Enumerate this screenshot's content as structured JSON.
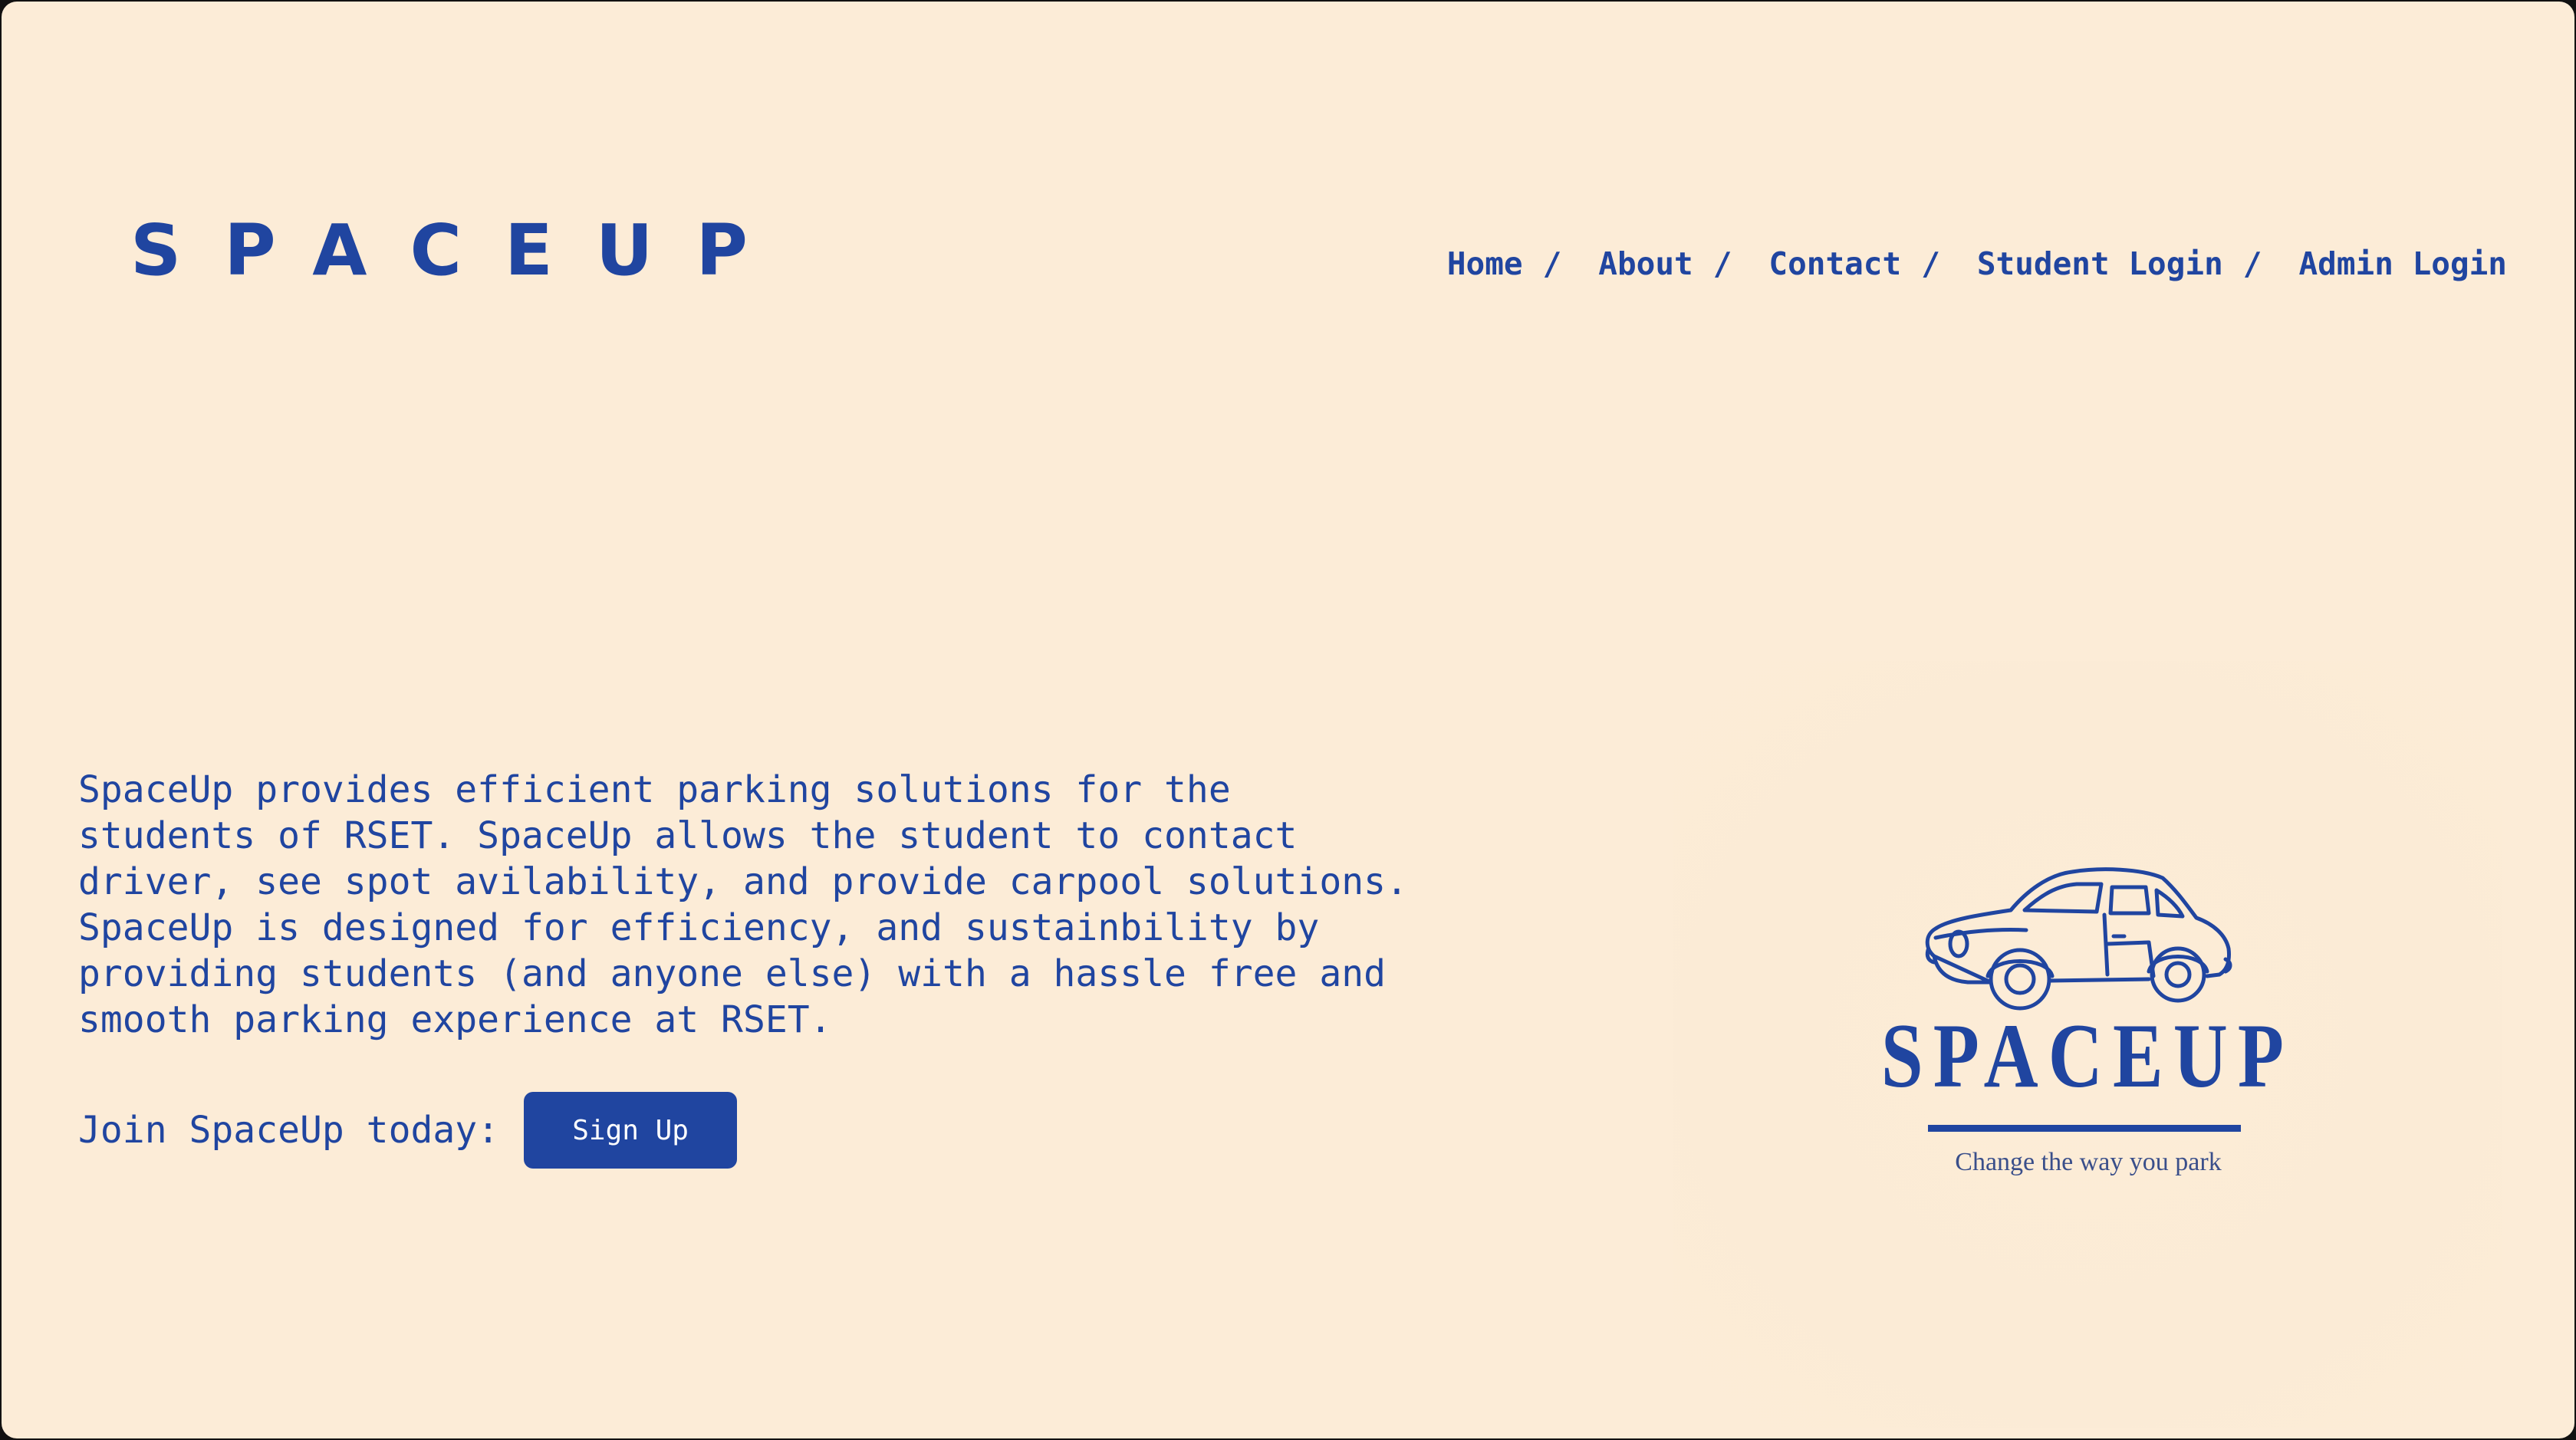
{
  "brand": {
    "title": "SPACEUP"
  },
  "nav": {
    "separator": "/",
    "items": [
      {
        "label": "Home"
      },
      {
        "label": "About"
      },
      {
        "label": "Contact"
      },
      {
        "label": "Student Login"
      },
      {
        "label": "Admin Login"
      }
    ]
  },
  "hero": {
    "description": "SpaceUp provides efficient parking solutions for the students of RSET. SpaceUp allows the student to contact driver, see spot avilability, and provide carpool solutions. SpaceUp is designed for efficiency, and sustainbility by providing students (and anyone else) with a hassle free and smooth parking experience at RSET.",
    "join_label": "Join SpaceUp today:",
    "signup_label": "Sign Up"
  },
  "logo": {
    "wordmark": "SPACEUP",
    "tagline": "Change the way you park",
    "icon": "car-icon"
  },
  "colors": {
    "background": "#fcecd7",
    "accent": "#2045a0",
    "button_text": "#ffffff"
  }
}
